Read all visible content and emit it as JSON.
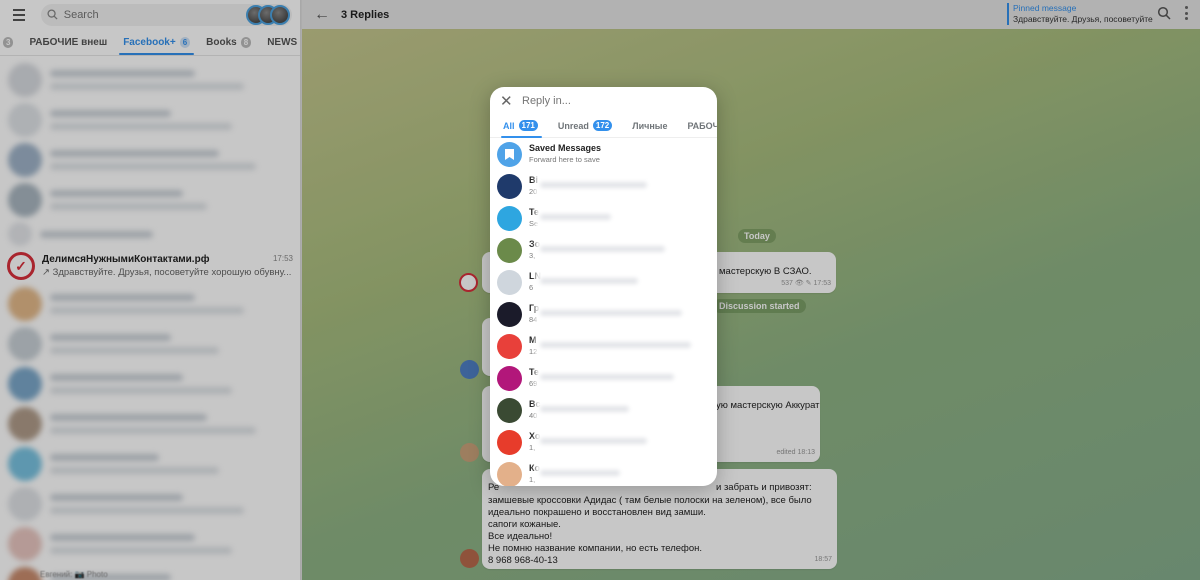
{
  "left": {
    "search_placeholder": "Search",
    "folders": [
      {
        "label": "",
        "badge": "3"
      },
      {
        "label": "РАБОЧИЕ внеш",
        "badge": ""
      },
      {
        "label": "Facebook+",
        "badge": "6"
      },
      {
        "label": "Books",
        "badge": "8"
      },
      {
        "label": "NEWS",
        "badge": "21"
      }
    ],
    "featured_chat": {
      "name": "ДелимсяНужнымиКонтактами.рф",
      "time": "17:53",
      "message": "Здравствуйте. Друзья, посоветуйте хорошую обувну..."
    },
    "bottom_text": "Евгений: 📷 Photo"
  },
  "chat": {
    "title": "3 Replies",
    "pinned_label": "Pinned message",
    "pinned_text": "Здравствуйте. Друзья, посоветуйте",
    "date_today": "Today",
    "msg1_tail": "мастерскую В СЗАО.",
    "msg1_views": "537",
    "msg1_time": "17:53",
    "discussion_started": "Discussion started",
    "msg2_tail": "ую мастерскую Аккурат",
    "msg2_meta": "edited 18:13",
    "msg3_first": "Ре",
    "msg3_first_tail": "и забрать и привозят:",
    "msg3_lines": [
      "замшевые кроссовки Адидас ( там  белые полоски на зеленом), все было",
      "идеально покрашено и восстановлен вид замши.",
      "сапоги кожаные.",
      "Все идеально!",
      "Не помню название компании, но есть телефон.",
      "8 968 968-40-13"
    ],
    "msg3_time": "18:57"
  },
  "modal": {
    "search_placeholder": "Reply in...",
    "tabs": [
      {
        "label": "All",
        "badge": "171"
      },
      {
        "label": "Unread",
        "badge": "172"
      },
      {
        "label": "Личные",
        "badge": ""
      },
      {
        "label": "РАБОЧИ",
        "badge": ""
      }
    ],
    "saved": {
      "name": "Saved Messages",
      "subtitle": "Forward here to save"
    },
    "items": [
      {
        "name": "Bi",
        "sub": "20",
        "color": "#1f3a6b"
      },
      {
        "name": "Te",
        "sub": "Se",
        "color": "#2ea6e0"
      },
      {
        "name": "Зо",
        "sub": "3,",
        "color": "#6b8a4a"
      },
      {
        "name": "LN",
        "sub": "6",
        "color": "#cfd6dd"
      },
      {
        "name": "Гр",
        "sub": "84",
        "color": "#1b1b2a"
      },
      {
        "name": "M",
        "sub": "12",
        "color": "#e8403a"
      },
      {
        "name": "Te",
        "sub": "69",
        "color": "#b2177a"
      },
      {
        "name": "Bc",
        "sub": "40",
        "color": "#3a4a33"
      },
      {
        "name": "Хо",
        "sub": "1,",
        "color": "#e73c2b"
      },
      {
        "name": "Ко",
        "sub": "1,",
        "color": "#e3b08a"
      }
    ]
  }
}
